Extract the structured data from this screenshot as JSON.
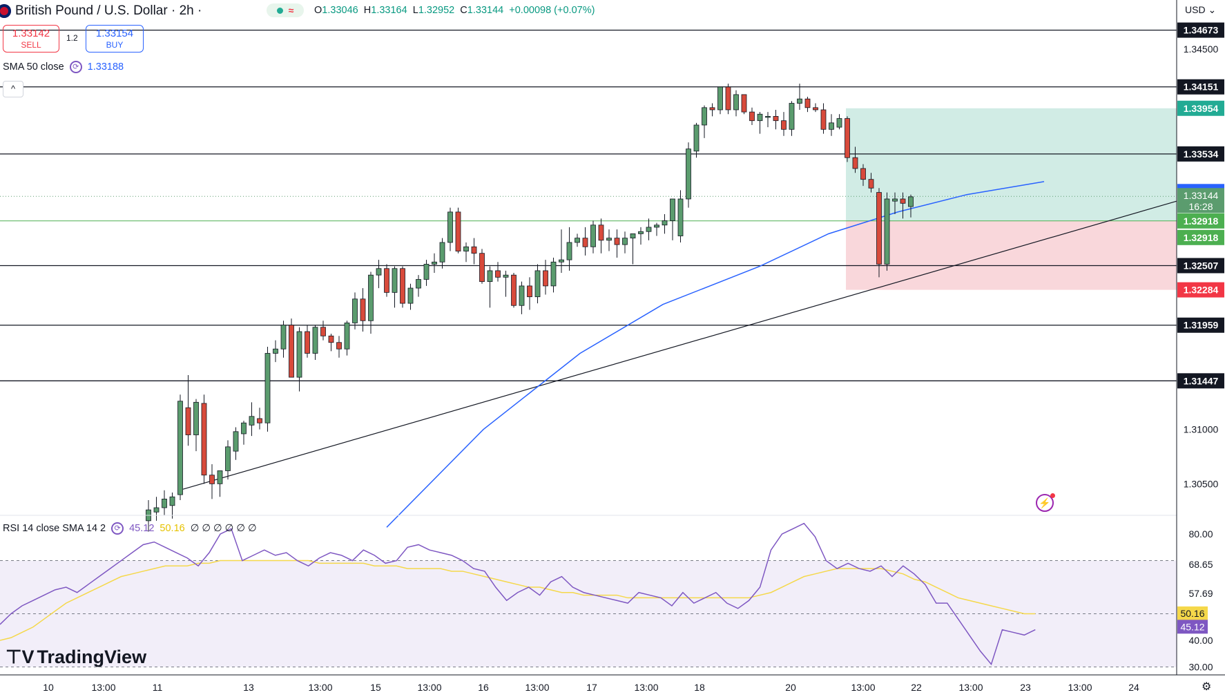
{
  "header": {
    "symbol": "British Pound / U.S. Dollar · 2h ·",
    "pill_icon": "≈",
    "ohlc": {
      "o_label": "O",
      "o": "1.33046",
      "h_label": "H",
      "h": "1.33164",
      "l_label": "L",
      "l": "1.32952",
      "c_label": "C",
      "c": "1.33144",
      "change": "+0.00098 (+0.07%)"
    },
    "sell_price": "1.33142",
    "sell_label": "SELL",
    "spread": "1.2",
    "buy_price": "1.33154",
    "buy_label": "BUY",
    "currency": "USD"
  },
  "indicators": {
    "sma_label": "SMA 50 close",
    "sma_value": "1.33188",
    "rsi_label": "RSI 14 close SMA 14 2",
    "rsi_value": "45.12",
    "rsi_sma_value": "50.16",
    "rsi_extra": "∅ ∅ ∅ ∅ ∅ ∅"
  },
  "logo": "TradingView",
  "colors": {
    "up": "#5b9c6e",
    "down": "#d84a3b",
    "sma": "#2962ff",
    "rsi": "#7e57c2",
    "rsi_sma": "#f5d84a",
    "tp_zone": "#b2dfd4",
    "sl_zone": "#f8d3d7"
  },
  "chart_data": {
    "type": "candlestick",
    "ylim": [
      1.3021,
      1.3495
    ],
    "y_ticks": [
      "1.34500",
      "1.31000",
      "1.30500"
    ],
    "x_ticks": [
      "10",
      "13:00",
      "11",
      "13",
      "13:00",
      "15",
      "13:00",
      "16",
      "13:00",
      "17",
      "13:00",
      "18",
      "20",
      "13:00",
      "22",
      "13:00",
      "23",
      "13:00",
      "24"
    ],
    "levels": [
      {
        "price": 1.34673,
        "label": "1.34673"
      },
      {
        "price": 1.34151,
        "label": "1.34151"
      },
      {
        "price": 1.33534,
        "label": "1.33534"
      },
      {
        "price": 1.32507,
        "label": "1.32507"
      },
      {
        "price": 1.31959,
        "label": "1.31959"
      },
      {
        "price": 1.31447,
        "label": "1.31447"
      }
    ],
    "position": {
      "take_profit": 1.33954,
      "entry": 1.32918,
      "stop": 1.32284,
      "tp_label": "1.33954",
      "entry_label": "1.32918",
      "stop_label": "1.32284"
    },
    "last_price": {
      "price": 1.33144,
      "label": "1.33144",
      "countdown": "16:28"
    },
    "sma_label_price": {
      "price": 1.33188,
      "label": "1.33188"
    },
    "trendline": [
      [
        1.3045,
        "11"
      ],
      [
        1.3291,
        "23 06:00"
      ]
    ],
    "candles": [
      [
        1.3016,
        1.3035,
        1.3006,
        1.3026
      ],
      [
        1.3024,
        1.3038,
        1.3016,
        1.3028
      ],
      [
        1.3028,
        1.3044,
        1.3021,
        1.3036
      ],
      [
        1.303,
        1.3042,
        1.3018,
        1.3038
      ],
      [
        1.304,
        1.3132,
        1.3035,
        1.3126
      ],
      [
        1.312,
        1.315,
        1.3085,
        1.3095
      ],
      [
        1.3095,
        1.3128,
        1.308,
        1.3125
      ],
      [
        1.3124,
        1.3132,
        1.305,
        1.3058
      ],
      [
        1.3058,
        1.3068,
        1.3036,
        1.305
      ],
      [
        1.305,
        1.3062,
        1.3038,
        1.3062
      ],
      [
        1.3062,
        1.309,
        1.3054,
        1.3084
      ],
      [
        1.308,
        1.3102,
        1.3072,
        1.3098
      ],
      [
        1.3096,
        1.3108,
        1.3086,
        1.3106
      ],
      [
        1.3104,
        1.3125,
        1.3094,
        1.3112
      ],
      [
        1.311,
        1.312,
        1.31,
        1.3106
      ],
      [
        1.3106,
        1.3176,
        1.3098,
        1.317
      ],
      [
        1.317,
        1.3182,
        1.3162,
        1.3174
      ],
      [
        1.3174,
        1.32,
        1.3166,
        1.3196
      ],
      [
        1.3196,
        1.3202,
        1.3148,
        1.3148
      ],
      [
        1.3148,
        1.3194,
        1.3135,
        1.319
      ],
      [
        1.319,
        1.3196,
        1.3166,
        1.317
      ],
      [
        1.317,
        1.3196,
        1.3164,
        1.3194
      ],
      [
        1.3194,
        1.32,
        1.3182,
        1.3186
      ],
      [
        1.3186,
        1.3188,
        1.3172,
        1.318
      ],
      [
        1.318,
        1.3186,
        1.3166,
        1.3174
      ],
      [
        1.3174,
        1.32,
        1.3168,
        1.3198
      ],
      [
        1.3198,
        1.3226,
        1.3192,
        1.322
      ],
      [
        1.322,
        1.323,
        1.319,
        1.32
      ],
      [
        1.32,
        1.3245,
        1.3188,
        1.3242
      ],
      [
        1.3242,
        1.3256,
        1.323,
        1.3248
      ],
      [
        1.3248,
        1.3252,
        1.3222,
        1.3226
      ],
      [
        1.3226,
        1.325,
        1.3212,
        1.3248
      ],
      [
        1.3248,
        1.325,
        1.3212,
        1.3216
      ],
      [
        1.3216,
        1.3234,
        1.321,
        1.323
      ],
      [
        1.323,
        1.3242,
        1.3222,
        1.3238
      ],
      [
        1.3238,
        1.3256,
        1.3232,
        1.3252
      ],
      [
        1.3252,
        1.3262,
        1.3244,
        1.3254
      ],
      [
        1.3254,
        1.3276,
        1.3248,
        1.3272
      ],
      [
        1.3272,
        1.3304,
        1.3264,
        1.33
      ],
      [
        1.33,
        1.3304,
        1.3262,
        1.3264
      ],
      [
        1.3264,
        1.3272,
        1.3254,
        1.3268
      ],
      [
        1.3268,
        1.3276,
        1.3252,
        1.3262
      ],
      [
        1.3262,
        1.3266,
        1.3234,
        1.3236
      ],
      [
        1.3236,
        1.325,
        1.3212,
        1.3246
      ],
      [
        1.3246,
        1.3254,
        1.3236,
        1.324
      ],
      [
        1.324,
        1.3246,
        1.3222,
        1.3242
      ],
      [
        1.3242,
        1.3244,
        1.3212,
        1.3214
      ],
      [
        1.3214,
        1.3236,
        1.3206,
        1.3232
      ],
      [
        1.3232,
        1.324,
        1.321,
        1.3222
      ],
      [
        1.3222,
        1.3252,
        1.3216,
        1.3246
      ],
      [
        1.3246,
        1.3256,
        1.3224,
        1.3232
      ],
      [
        1.3232,
        1.3258,
        1.3226,
        1.3254
      ],
      [
        1.3254,
        1.3284,
        1.3244,
        1.3256
      ],
      [
        1.3256,
        1.3286,
        1.3246,
        1.3272
      ],
      [
        1.3272,
        1.328,
        1.3268,
        1.3276
      ],
      [
        1.3276,
        1.3286,
        1.326,
        1.3268
      ],
      [
        1.3268,
        1.3292,
        1.3262,
        1.3288
      ],
      [
        1.3288,
        1.3294,
        1.3262,
        1.3274
      ],
      [
        1.3274,
        1.3284,
        1.3264,
        1.3276
      ],
      [
        1.3276,
        1.3284,
        1.3258,
        1.327
      ],
      [
        1.327,
        1.3282,
        1.3262,
        1.3276
      ],
      [
        1.3276,
        1.328,
        1.3252,
        1.328
      ],
      [
        1.328,
        1.3286,
        1.327,
        1.3282
      ],
      [
        1.3282,
        1.3294,
        1.3274,
        1.3286
      ],
      [
        1.3286,
        1.329,
        1.3278,
        1.3288
      ],
      [
        1.3288,
        1.3298,
        1.328,
        1.3292
      ],
      [
        1.3292,
        1.3312,
        1.3274,
        1.3312
      ],
      [
        1.3278,
        1.332,
        1.3272,
        1.3312
      ],
      [
        1.3312,
        1.3364,
        1.3304,
        1.3358
      ],
      [
        1.3356,
        1.3382,
        1.335,
        1.338
      ],
      [
        1.338,
        1.3398,
        1.3368,
        1.3396
      ],
      [
        1.3396,
        1.34,
        1.3388,
        1.3394
      ],
      [
        1.3394,
        1.3415,
        1.339,
        1.3415
      ],
      [
        1.3415,
        1.3418,
        1.339,
        1.3394
      ],
      [
        1.3394,
        1.3412,
        1.3388,
        1.3408
      ],
      [
        1.3408,
        1.3408,
        1.339,
        1.3392
      ],
      [
        1.3392,
        1.3396,
        1.338,
        1.3384
      ],
      [
        1.3384,
        1.3392,
        1.3372,
        1.339
      ],
      [
        1.3388,
        1.3392,
        1.3378,
        1.3388
      ],
      [
        1.3388,
        1.3394,
        1.3376,
        1.3384
      ],
      [
        1.3384,
        1.3392,
        1.337,
        1.3376
      ],
      [
        1.3376,
        1.3402,
        1.337,
        1.34
      ],
      [
        1.34,
        1.3418,
        1.3394,
        1.3404
      ],
      [
        1.3404,
        1.3406,
        1.3392,
        1.3396
      ],
      [
        1.3396,
        1.34,
        1.3392,
        1.3394
      ],
      [
        1.3394,
        1.34,
        1.3372,
        1.3376
      ],
      [
        1.3376,
        1.339,
        1.337,
        1.3382
      ],
      [
        1.3378,
        1.339,
        1.3376,
        1.3386
      ],
      [
        1.3386,
        1.3388,
        1.3346,
        1.335
      ],
      [
        1.335,
        1.336,
        1.3336,
        1.334
      ],
      [
        1.334,
        1.3344,
        1.3324,
        1.333
      ],
      [
        1.333,
        1.3336,
        1.3318,
        1.3322
      ],
      [
        1.3318,
        1.3322,
        1.324,
        1.3252
      ],
      [
        1.3252,
        1.3318,
        1.3246,
        1.3312
      ],
      [
        1.331,
        1.3318,
        1.3298,
        1.3312
      ],
      [
        1.3312,
        1.3318,
        1.3294,
        1.3308
      ],
      [
        1.3305,
        1.3316,
        1.3295,
        1.3314
      ]
    ],
    "sma50": [
      [
        11,
        1.3
      ],
      [
        22,
        1.308
      ],
      [
        40,
        1.316
      ],
      [
        55,
        1.3213
      ],
      [
        70,
        1.3262
      ],
      [
        85,
        1.3305
      ],
      [
        97,
        1.332
      ]
    ],
    "rsi_panel": {
      "ylim": [
        27,
        86
      ],
      "y_ticks": [
        "80.00",
        "68.65",
        "57.69",
        "40.00",
        "30.00"
      ],
      "bands": {
        "upper": 70,
        "mid": 50,
        "lower": 30
      },
      "rsi": [
        46,
        50,
        53,
        55,
        57,
        59,
        60,
        58,
        61,
        64,
        67,
        70,
        73,
        76,
        77,
        75,
        73,
        71,
        68,
        73,
        80,
        82,
        70,
        72,
        74,
        72,
        73,
        70,
        68,
        71,
        73,
        72,
        70,
        74,
        72,
        69,
        70,
        75,
        76,
        74,
        73,
        72,
        70,
        67,
        66,
        60,
        55,
        58,
        60,
        57,
        62,
        64,
        60,
        58,
        57,
        56,
        55,
        54,
        58,
        57,
        56,
        53,
        58,
        54,
        56,
        58,
        54,
        52,
        55,
        60,
        74,
        80,
        82,
        84,
        79,
        70,
        67,
        69,
        67,
        66,
        68,
        64,
        68,
        65,
        61,
        54,
        54,
        48,
        42,
        36,
        31,
        44,
        43,
        42,
        44
      ],
      "rsi_sma": [
        40,
        41,
        43,
        45,
        48,
        51,
        54,
        56,
        58,
        60,
        62,
        64,
        65,
        66,
        67,
        68,
        68,
        68,
        69,
        69,
        70,
        70,
        70,
        70,
        70,
        70,
        70,
        70,
        70,
        69,
        69,
        69,
        69,
        69,
        68,
        68,
        68,
        67,
        67,
        67,
        67,
        66,
        66,
        65,
        64,
        63,
        62,
        61,
        60,
        60,
        59,
        58,
        58,
        57,
        57,
        57,
        57,
        56,
        56,
        56,
        56,
        56,
        56,
        56,
        56,
        56,
        56,
        56,
        56,
        57,
        58,
        60,
        62,
        64,
        65,
        66,
        67,
        67,
        67,
        67,
        67,
        66,
        65,
        63,
        62,
        60,
        58,
        56,
        55,
        54,
        53,
        52,
        51,
        50,
        50
      ]
    }
  }
}
